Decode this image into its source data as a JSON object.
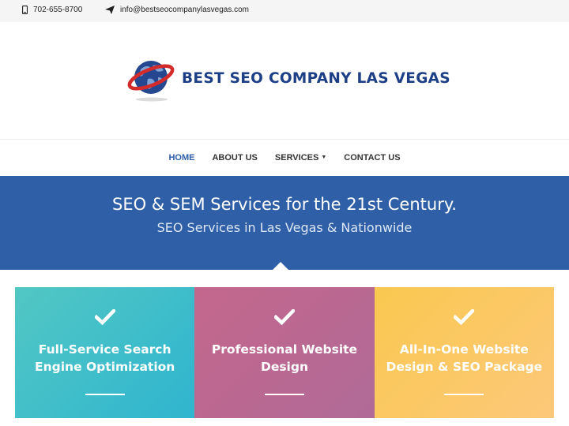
{
  "topbar": {
    "phone": "702-655-8700",
    "email": "info@bestseocompanylasvegas.com"
  },
  "logo": {
    "text": "BEST SEO COMPANY LAS VEGAS"
  },
  "nav": {
    "items": [
      {
        "label": "HOME",
        "active": true
      },
      {
        "label": "ABOUT US"
      },
      {
        "label": "SERVICES",
        "has_dropdown": true
      },
      {
        "label": "CONTACT US"
      }
    ]
  },
  "hero": {
    "title": "SEO & SEM Services for the 21st Century.",
    "subtitle": "SEO Services in Las Vegas & Nationwide"
  },
  "cards": [
    {
      "title": "Full-Service Search Engine Optimization",
      "icon": "check-icon"
    },
    {
      "title": "Professional Website Design",
      "icon": "check-icon"
    },
    {
      "title": "All-In-One Website Design & SEO Package",
      "icon": "check-icon"
    }
  ],
  "colors": {
    "brand_blue": "#2f5fa6",
    "logo_blue": "#1d3f86",
    "card_teal": "#3bbccc",
    "card_mauve": "#bb6890",
    "card_yellow": "#fbc860"
  }
}
